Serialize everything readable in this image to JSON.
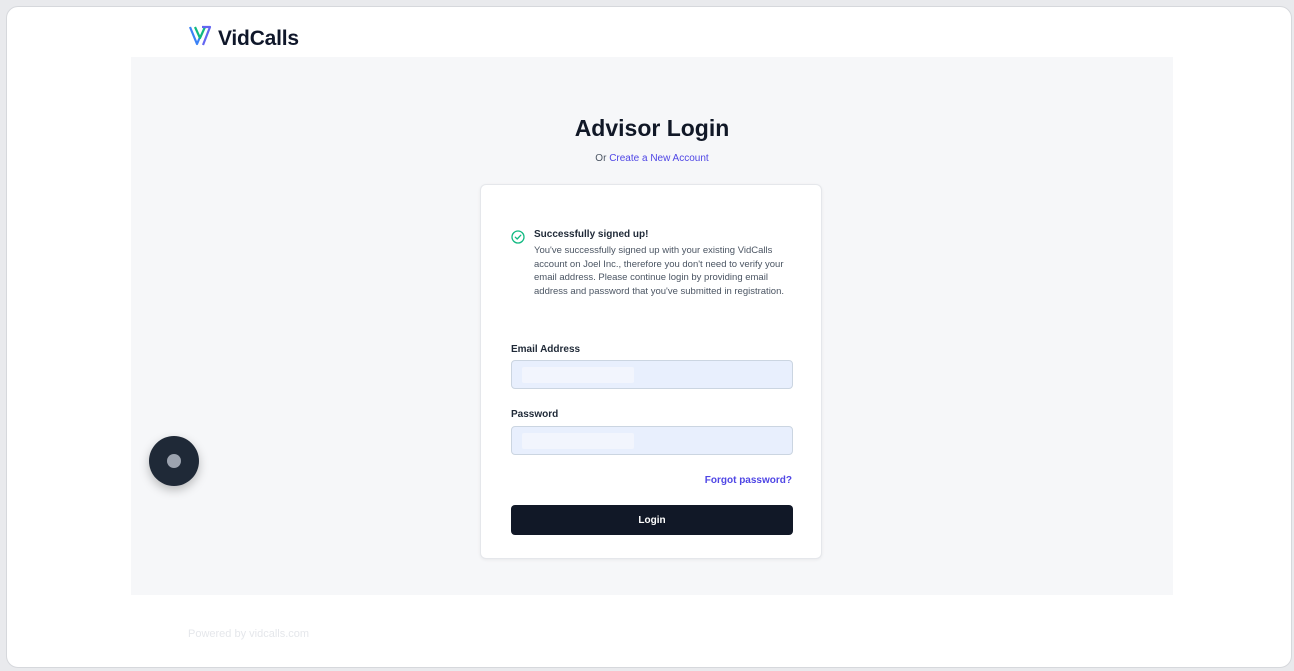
{
  "brand": {
    "name": "VidCalls",
    "accent": "#2563eb"
  },
  "header": {
    "title": "Advisor Login",
    "or_text": "Or",
    "create_link": "Create a New Account"
  },
  "alert": {
    "icon": "check-circle-icon",
    "color": "#10b981",
    "title": "Successfully signed up!",
    "body": "You've successfully signed up with your existing VidCalls account on Joel Inc., therefore you don't need to verify your email address. Please continue login by providing email address and password that you've submitted in registration."
  },
  "form": {
    "email_label": "Email Address",
    "password_label": "Password",
    "forgot_link": "Forgot password?",
    "login_button": "Login"
  },
  "footer": {
    "text": "Powered by vidcalls.com"
  }
}
